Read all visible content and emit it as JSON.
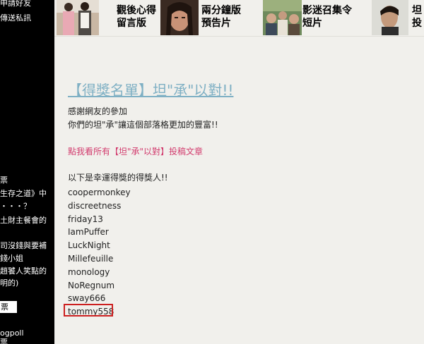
{
  "sidebar": {
    "top_lines": [
      "申請好友",
      "傳送私訊"
    ],
    "mid_lines": [
      "票",
      "生存之道》中",
      "・・・？",
      "土財主餐會的"
    ],
    "lower_lines": [
      "司沒錢與要補",
      "錢小姐",
      "趙饕人笑點的",
      "明的)"
    ],
    "box_label": "票",
    "bottom_lines": [
      "ogpoll",
      "票"
    ]
  },
  "banner": {
    "items": [
      {
        "label": "觀後心得\n留言版",
        "icon": "couple-photo"
      },
      {
        "label": "兩分鐘版\n預告片",
        "icon": "actress-photo"
      },
      {
        "label": "影迷召集令\n短片",
        "icon": "group-photo"
      },
      {
        "label": "坦\n投",
        "icon": "actor-photo"
      }
    ]
  },
  "post": {
    "title": "【得獎名單】坦\"承\"以對!!",
    "thanks": "感謝網友的參加",
    "thanks2": "你們的坦\"承\"讓這個部落格更加的豐富!!",
    "view_link": "點我看所有【坦\"承\"以對】投稿文章",
    "winners_intro": "以下是幸運得獎的得獎人!!",
    "winners": [
      "coopermonkey",
      "discreetness",
      "friday13",
      "IamPuffer",
      "LuckNight",
      "Millefeuille",
      "monology",
      "NoRegnum",
      "sway666",
      "tommy558"
    ]
  },
  "colors": {
    "title": "#7fb0c4",
    "link": "#d23c6e",
    "highlight_border": "#cc1f1f",
    "sidebar_bg": "#000000",
    "page_bg": "#f1f0ec"
  }
}
